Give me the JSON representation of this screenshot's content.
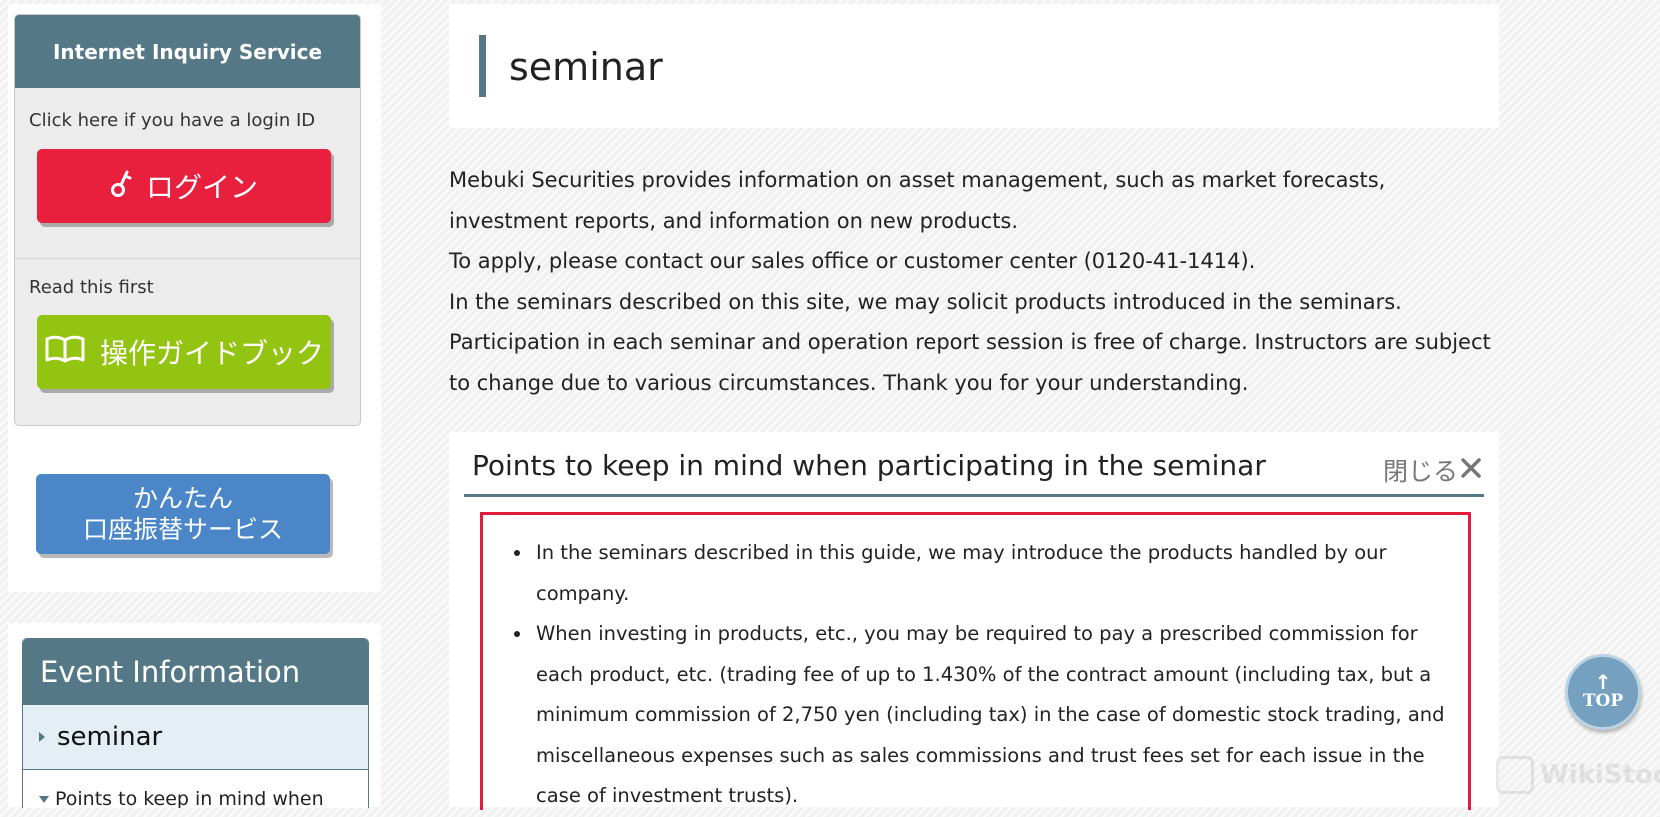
{
  "sidebar": {
    "inquiry": {
      "title": "Internet Inquiry Service",
      "login_hint": "Click here if you have a login ID",
      "login_button": "ログイン",
      "guide_hint": "Read this first",
      "guide_button": "操作ガイドブック"
    },
    "transfer_button": {
      "line1": "かんたん",
      "line2": "口座振替サービス"
    },
    "event": {
      "title": "Event Information",
      "items": [
        {
          "label": "seminar"
        },
        {
          "label": "Points to keep in mind when"
        }
      ]
    }
  },
  "main": {
    "title": "seminar",
    "intro": [
      "Mebuki Securities provides information on asset management, such as market forecasts, investment reports, and information on new products.",
      "To apply, please contact our sales office or customer center (0120-41-1414).",
      "In the seminars described on this site, we may solicit products introduced in the seminars.",
      "Participation in each seminar and operation report session is free of charge. Instructors are subject to change due to various circumstances. Thank you for your understanding."
    ],
    "points": {
      "title": "Points to keep in mind when participating in the seminar",
      "close_label": "閉じる",
      "items": [
        "In the seminars described in this guide, we may introduce the products handled by our company.",
        "When investing in products, etc., you may be required to pay a prescribed commission for each product, etc. (trading fee of up to 1.430% of the contract amount (including tax, but a minimum commission of 2,750 yen (including tax) in the case of domestic stock trading, and miscellaneous expenses such as sales commissions and trust fees set for each issue in the case of investment trusts)."
      ]
    }
  },
  "top_button": {
    "label": "TOP",
    "arrow": "↑"
  },
  "watermark": "WikiStock",
  "colors": {
    "header": "#557887",
    "login": "#e8203e",
    "guide": "#94c412",
    "transfer": "#4a86c8",
    "alert_border": "#e11d3c"
  }
}
